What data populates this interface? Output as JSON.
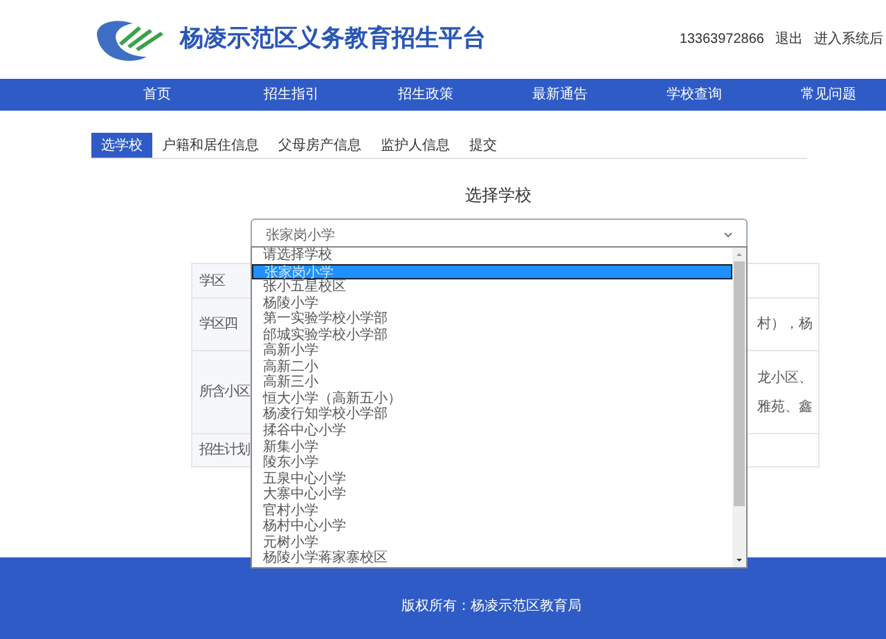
{
  "header": {
    "title": "杨凌示范区义务教育招生平台",
    "phone": "13363972866",
    "links": [
      "退出",
      "进入系统后"
    ]
  },
  "nav": [
    {
      "label": "首页"
    },
    {
      "label": "招生指引"
    },
    {
      "label": "招生政策"
    },
    {
      "label": "最新通告"
    },
    {
      "label": "学校查询"
    },
    {
      "label": "常见问题"
    }
  ],
  "tabs": [
    {
      "label": "选学校",
      "selected": true
    },
    {
      "label": "户籍和居住信息",
      "selected": false
    },
    {
      "label": "父母房产信息",
      "selected": false
    },
    {
      "label": "监护人信息",
      "selected": false
    },
    {
      "label": "提交",
      "selected": false
    }
  ],
  "section_title": "选择学校",
  "school_select": {
    "value": "张家岗小学",
    "expanded": true,
    "options": [
      {
        "label": "请选择学校",
        "selected": false
      },
      {
        "label": "张家岗小学",
        "selected": true
      },
      {
        "label": "张小五星校区",
        "selected": false
      },
      {
        "label": "杨陵小学",
        "selected": false
      },
      {
        "label": "第一实验学校小学部",
        "selected": false
      },
      {
        "label": "邰城实验学校小学部",
        "selected": false
      },
      {
        "label": "高新小学",
        "selected": false
      },
      {
        "label": "高新二小",
        "selected": false
      },
      {
        "label": "高新三小",
        "selected": false
      },
      {
        "label": "恒大小学（高新五小）",
        "selected": false
      },
      {
        "label": "杨凌行知学校小学部",
        "selected": false
      },
      {
        "label": "揉谷中心小学",
        "selected": false
      },
      {
        "label": "新集小学",
        "selected": false
      },
      {
        "label": "陵东小学",
        "selected": false
      },
      {
        "label": "五泉中心小学",
        "selected": false
      },
      {
        "label": "大寨中心小学",
        "selected": false
      },
      {
        "label": "官村小学",
        "selected": false
      },
      {
        "label": "杨村中心小学",
        "selected": false
      },
      {
        "label": "元树小学",
        "selected": false
      },
      {
        "label": "杨陵小学蒋家寨校区",
        "selected": false
      }
    ]
  },
  "table": {
    "rows": [
      {
        "label": "学区",
        "value": []
      },
      {
        "label": "学区四",
        "value": [
          "村），杨"
        ]
      },
      {
        "label": "所含小区",
        "value": [
          "龙小区、",
          "雅苑、鑫"
        ]
      },
      {
        "label": "招生计划",
        "value": []
      }
    ]
  },
  "footer": {
    "copyright": "版权所有：杨凌示范区教育局"
  }
}
